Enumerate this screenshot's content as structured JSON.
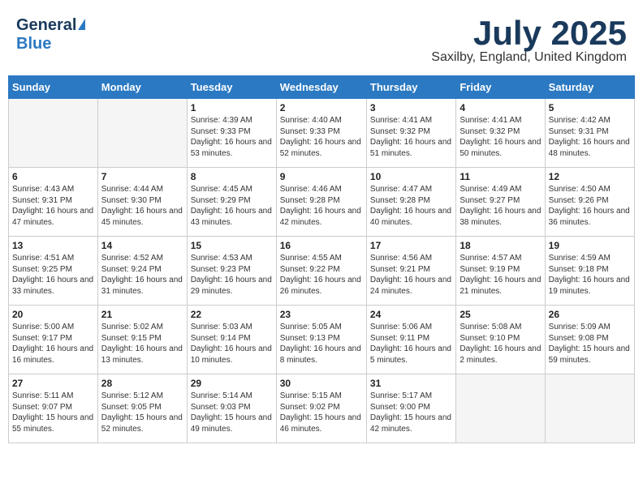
{
  "header": {
    "logo_general": "General",
    "logo_blue": "Blue",
    "month": "July 2025",
    "location": "Saxilby, England, United Kingdom"
  },
  "days_of_week": [
    "Sunday",
    "Monday",
    "Tuesday",
    "Wednesday",
    "Thursday",
    "Friday",
    "Saturday"
  ],
  "weeks": [
    [
      {
        "day": "",
        "sunrise": "",
        "sunset": "",
        "daylight": "",
        "empty": true
      },
      {
        "day": "",
        "sunrise": "",
        "sunset": "",
        "daylight": "",
        "empty": true
      },
      {
        "day": "1",
        "sunrise": "Sunrise: 4:39 AM",
        "sunset": "Sunset: 9:33 PM",
        "daylight": "Daylight: 16 hours and 53 minutes."
      },
      {
        "day": "2",
        "sunrise": "Sunrise: 4:40 AM",
        "sunset": "Sunset: 9:33 PM",
        "daylight": "Daylight: 16 hours and 52 minutes."
      },
      {
        "day": "3",
        "sunrise": "Sunrise: 4:41 AM",
        "sunset": "Sunset: 9:32 PM",
        "daylight": "Daylight: 16 hours and 51 minutes."
      },
      {
        "day": "4",
        "sunrise": "Sunrise: 4:41 AM",
        "sunset": "Sunset: 9:32 PM",
        "daylight": "Daylight: 16 hours and 50 minutes."
      },
      {
        "day": "5",
        "sunrise": "Sunrise: 4:42 AM",
        "sunset": "Sunset: 9:31 PM",
        "daylight": "Daylight: 16 hours and 48 minutes."
      }
    ],
    [
      {
        "day": "6",
        "sunrise": "Sunrise: 4:43 AM",
        "sunset": "Sunset: 9:31 PM",
        "daylight": "Daylight: 16 hours and 47 minutes."
      },
      {
        "day": "7",
        "sunrise": "Sunrise: 4:44 AM",
        "sunset": "Sunset: 9:30 PM",
        "daylight": "Daylight: 16 hours and 45 minutes."
      },
      {
        "day": "8",
        "sunrise": "Sunrise: 4:45 AM",
        "sunset": "Sunset: 9:29 PM",
        "daylight": "Daylight: 16 hours and 43 minutes."
      },
      {
        "day": "9",
        "sunrise": "Sunrise: 4:46 AM",
        "sunset": "Sunset: 9:28 PM",
        "daylight": "Daylight: 16 hours and 42 minutes."
      },
      {
        "day": "10",
        "sunrise": "Sunrise: 4:47 AM",
        "sunset": "Sunset: 9:28 PM",
        "daylight": "Daylight: 16 hours and 40 minutes."
      },
      {
        "day": "11",
        "sunrise": "Sunrise: 4:49 AM",
        "sunset": "Sunset: 9:27 PM",
        "daylight": "Daylight: 16 hours and 38 minutes."
      },
      {
        "day": "12",
        "sunrise": "Sunrise: 4:50 AM",
        "sunset": "Sunset: 9:26 PM",
        "daylight": "Daylight: 16 hours and 36 minutes."
      }
    ],
    [
      {
        "day": "13",
        "sunrise": "Sunrise: 4:51 AM",
        "sunset": "Sunset: 9:25 PM",
        "daylight": "Daylight: 16 hours and 33 minutes."
      },
      {
        "day": "14",
        "sunrise": "Sunrise: 4:52 AM",
        "sunset": "Sunset: 9:24 PM",
        "daylight": "Daylight: 16 hours and 31 minutes."
      },
      {
        "day": "15",
        "sunrise": "Sunrise: 4:53 AM",
        "sunset": "Sunset: 9:23 PM",
        "daylight": "Daylight: 16 hours and 29 minutes."
      },
      {
        "day": "16",
        "sunrise": "Sunrise: 4:55 AM",
        "sunset": "Sunset: 9:22 PM",
        "daylight": "Daylight: 16 hours and 26 minutes."
      },
      {
        "day": "17",
        "sunrise": "Sunrise: 4:56 AM",
        "sunset": "Sunset: 9:21 PM",
        "daylight": "Daylight: 16 hours and 24 minutes."
      },
      {
        "day": "18",
        "sunrise": "Sunrise: 4:57 AM",
        "sunset": "Sunset: 9:19 PM",
        "daylight": "Daylight: 16 hours and 21 minutes."
      },
      {
        "day": "19",
        "sunrise": "Sunrise: 4:59 AM",
        "sunset": "Sunset: 9:18 PM",
        "daylight": "Daylight: 16 hours and 19 minutes."
      }
    ],
    [
      {
        "day": "20",
        "sunrise": "Sunrise: 5:00 AM",
        "sunset": "Sunset: 9:17 PM",
        "daylight": "Daylight: 16 hours and 16 minutes."
      },
      {
        "day": "21",
        "sunrise": "Sunrise: 5:02 AM",
        "sunset": "Sunset: 9:15 PM",
        "daylight": "Daylight: 16 hours and 13 minutes."
      },
      {
        "day": "22",
        "sunrise": "Sunrise: 5:03 AM",
        "sunset": "Sunset: 9:14 PM",
        "daylight": "Daylight: 16 hours and 10 minutes."
      },
      {
        "day": "23",
        "sunrise": "Sunrise: 5:05 AM",
        "sunset": "Sunset: 9:13 PM",
        "daylight": "Daylight: 16 hours and 8 minutes."
      },
      {
        "day": "24",
        "sunrise": "Sunrise: 5:06 AM",
        "sunset": "Sunset: 9:11 PM",
        "daylight": "Daylight: 16 hours and 5 minutes."
      },
      {
        "day": "25",
        "sunrise": "Sunrise: 5:08 AM",
        "sunset": "Sunset: 9:10 PM",
        "daylight": "Daylight: 16 hours and 2 minutes."
      },
      {
        "day": "26",
        "sunrise": "Sunrise: 5:09 AM",
        "sunset": "Sunset: 9:08 PM",
        "daylight": "Daylight: 15 hours and 59 minutes."
      }
    ],
    [
      {
        "day": "27",
        "sunrise": "Sunrise: 5:11 AM",
        "sunset": "Sunset: 9:07 PM",
        "daylight": "Daylight: 15 hours and 55 minutes."
      },
      {
        "day": "28",
        "sunrise": "Sunrise: 5:12 AM",
        "sunset": "Sunset: 9:05 PM",
        "daylight": "Daylight: 15 hours and 52 minutes."
      },
      {
        "day": "29",
        "sunrise": "Sunrise: 5:14 AM",
        "sunset": "Sunset: 9:03 PM",
        "daylight": "Daylight: 15 hours and 49 minutes."
      },
      {
        "day": "30",
        "sunrise": "Sunrise: 5:15 AM",
        "sunset": "Sunset: 9:02 PM",
        "daylight": "Daylight: 15 hours and 46 minutes."
      },
      {
        "day": "31",
        "sunrise": "Sunrise: 5:17 AM",
        "sunset": "Sunset: 9:00 PM",
        "daylight": "Daylight: 15 hours and 42 minutes."
      },
      {
        "day": "",
        "sunrise": "",
        "sunset": "",
        "daylight": "",
        "empty": true
      },
      {
        "day": "",
        "sunrise": "",
        "sunset": "",
        "daylight": "",
        "empty": true
      }
    ]
  ]
}
